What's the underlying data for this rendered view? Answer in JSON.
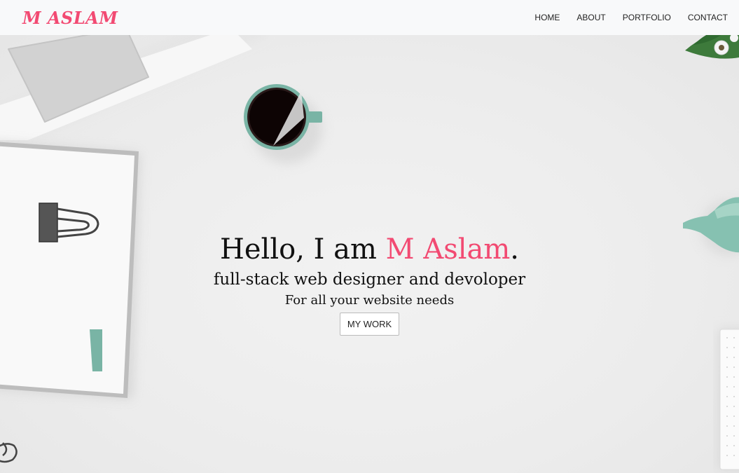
{
  "navbar": {
    "brand": "M ASLAM",
    "links": [
      {
        "label": "HOME"
      },
      {
        "label": "ABOUT"
      },
      {
        "label": "PORTFOLIO"
      },
      {
        "label": "CONTACT"
      }
    ]
  },
  "hero": {
    "greeting": "Hello, I am ",
    "name": "M Aslam",
    "period": ".",
    "subtitle": "full-stack web designer and devoloper",
    "tagline": "For all your website needs",
    "button_label": "MY WORK"
  },
  "colors": {
    "accent": "#f24a72",
    "navbar_bg": "#f8f9fa",
    "page_bg": "#efefef",
    "mint": "#79b4a5"
  }
}
